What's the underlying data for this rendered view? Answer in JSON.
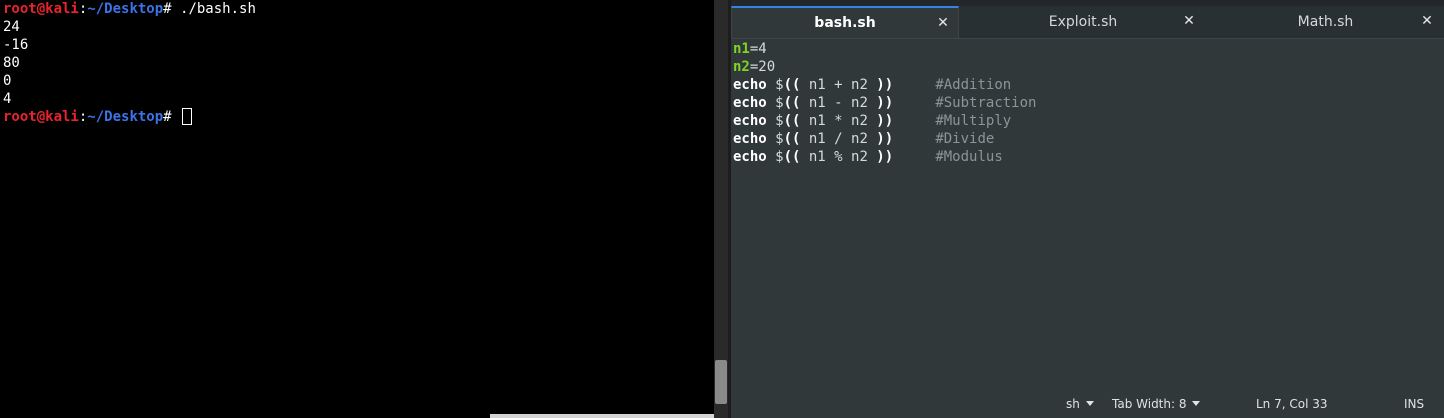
{
  "terminal": {
    "prompt": {
      "user_host": "root@kali",
      "sep": ":",
      "path": "~/Desktop",
      "hash": "# "
    },
    "command": "./bash.sh",
    "output": [
      "24",
      "-16",
      "80",
      "0",
      "4"
    ]
  },
  "editor": {
    "tabs": [
      {
        "label": "bash.sh",
        "close": "✕"
      },
      {
        "label": "Exploit.sh",
        "close": "✕"
      },
      {
        "label": "Math.sh",
        "close": "✕"
      }
    ],
    "code": {
      "assign": [
        {
          "var": "n1",
          "rest": "=4"
        },
        {
          "var": "n2",
          "rest": "=20"
        }
      ],
      "echo_lines": [
        {
          "kw": "echo",
          "dollar": " $",
          "open": "((",
          "expr": " n1 + n2 ",
          "close": "))",
          "pad": "     ",
          "comment": "#Addition"
        },
        {
          "kw": "echo",
          "dollar": " $",
          "open": "((",
          "expr": " n1 - n2 ",
          "close": "))",
          "pad": "     ",
          "comment": "#Subtraction"
        },
        {
          "kw": "echo",
          "dollar": " $",
          "open": "((",
          "expr": " n1 * n2 ",
          "close": "))",
          "pad": "     ",
          "comment": "#Multiply"
        },
        {
          "kw": "echo",
          "dollar": " $",
          "open": "((",
          "expr": " n1 / n2 ",
          "close": "))",
          "pad": "     ",
          "comment": "#Divide"
        },
        {
          "kw": "echo",
          "dollar": " $",
          "open": "((",
          "expr": " n1 % n2 ",
          "close": "))",
          "pad": "     ",
          "comment": "#Modulus"
        }
      ]
    },
    "status": {
      "language": "sh",
      "tab_width": "Tab Width: 8",
      "position": "Ln 7, Col 33",
      "mode": "INS"
    }
  },
  "colors": {
    "terminal_bg": "#000000",
    "prompt_user": "#e8232e",
    "prompt_path": "#3b73e8",
    "editor_bg": "#30383a",
    "variable": "#7fd424",
    "comment": "#8a9597",
    "tab_accent": "#3584e4"
  }
}
